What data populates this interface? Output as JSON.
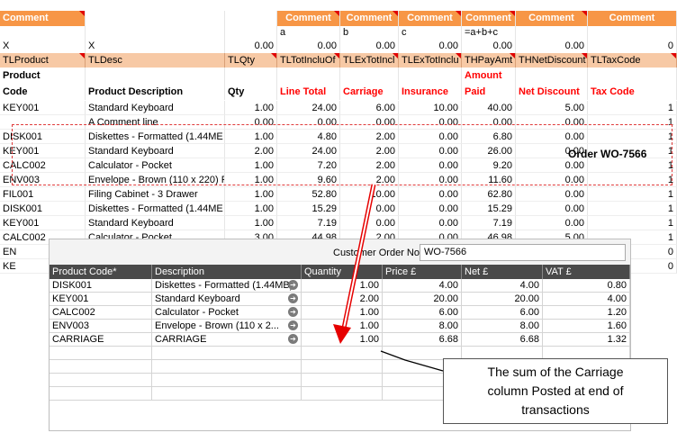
{
  "comment_row": {
    "first": "Comment",
    "cols": [
      "Comment",
      "Comment",
      "Comment",
      "Comment",
      "Comment",
      "Comment"
    ]
  },
  "formula_row": [
    "a",
    "b",
    "c",
    "=a+b+c"
  ],
  "x_row": {
    "a": "X",
    "b": "X",
    "qty": "0.00",
    "vals": [
      "0.00",
      "0.00",
      "0.00",
      "0.00",
      "0.00",
      "0"
    ]
  },
  "tl_row": [
    "TLProduct",
    "TLDesc",
    "TLQty",
    "TLTotIncluOf",
    "TLExTotIncl",
    "TLExTotInclu",
    "THPayAmt",
    "THNetDiscount",
    "TLTaxCode"
  ],
  "headers": {
    "product": [
      "Product",
      "Code"
    ],
    "desc": "Product Description",
    "qty": "Qty",
    "line_total": "Line Total",
    "carriage": "Carriage",
    "insurance": "Insurance",
    "amount_paid": [
      "Amount",
      "Paid"
    ],
    "net_discount": "Net Discount",
    "tax_code": "Tax Code"
  },
  "rows": [
    {
      "code": "KEY001",
      "desc": "Standard Keyboard",
      "qty": "1.00",
      "total": "24.00",
      "carriage": "6.00",
      "insurance": "10.00",
      "paid": "40.00",
      "discount": "5.00",
      "tax": "1"
    },
    {
      "code": "",
      "desc": "A Comment line",
      "qty": "0.00",
      "total": "0.00",
      "carriage": "0.00",
      "insurance": "0.00",
      "paid": "0.00",
      "discount": "0.00",
      "tax": "1"
    },
    {
      "code": "DISK001",
      "desc": "Diskettes - Formatted (1.44ME",
      "qty": "1.00",
      "total": "4.80",
      "carriage": "2.00",
      "insurance": "0.00",
      "paid": "6.80",
      "discount": "0.00",
      "tax": "1"
    },
    {
      "code": "KEY001",
      "desc": "Standard Keyboard",
      "qty": "2.00",
      "total": "24.00",
      "carriage": "2.00",
      "insurance": "0.00",
      "paid": "26.00",
      "discount": "0.00",
      "tax": "1"
    },
    {
      "code": "CALC002",
      "desc": "Calculator - Pocket",
      "qty": "1.00",
      "total": "7.20",
      "carriage": "2.00",
      "insurance": "0.00",
      "paid": "9.20",
      "discount": "0.00",
      "tax": "1"
    },
    {
      "code": "ENV003",
      "desc": "Envelope - Brown (110 x 220) F",
      "qty": "1.00",
      "total": "9.60",
      "carriage": "2.00",
      "insurance": "0.00",
      "paid": "11.60",
      "discount": "0.00",
      "tax": "1"
    },
    {
      "code": "FIL001",
      "desc": "Filing Cabinet - 3 Drawer",
      "qty": "1.00",
      "total": "52.80",
      "carriage": "10.00",
      "insurance": "0.00",
      "paid": "62.80",
      "discount": "0.00",
      "tax": "1"
    },
    {
      "code": "DISK001",
      "desc": "Diskettes - Formatted (1.44ME",
      "qty": "1.00",
      "total": "15.29",
      "carriage": "0.00",
      "insurance": "0.00",
      "paid": "15.29",
      "discount": "0.00",
      "tax": "1"
    },
    {
      "code": "KEY001",
      "desc": "Standard Keyboard",
      "qty": "1.00",
      "total": "7.19",
      "carriage": "0.00",
      "insurance": "0.00",
      "paid": "7.19",
      "discount": "0.00",
      "tax": "1"
    },
    {
      "code": "CALC002",
      "desc": "Calculator - Pocket",
      "qty": "3.00",
      "total": "44.98",
      "carriage": "2.00",
      "insurance": "0.00",
      "paid": "46.98",
      "discount": "5.00",
      "tax": "1"
    },
    {
      "code": "EN",
      "desc": "",
      "qty": "",
      "total": "",
      "carriage": "",
      "insurance": "",
      "paid": "",
      "discount": "",
      "tax": "0"
    },
    {
      "code": "KE",
      "desc": "",
      "qty": "",
      "total": "",
      "carriage": "",
      "insurance": "",
      "paid": "",
      "discount": "",
      "tax": "0"
    }
  ],
  "order_label": "Order WO-7566",
  "dialog": {
    "customer_order_label": "Customer Order No.",
    "customer_order_value": "WO-7566",
    "columns": [
      "Product Code*",
      "Description",
      "Quantity",
      "Price £",
      "Net £",
      "VAT £"
    ],
    "rows": [
      {
        "code": "DISK001",
        "desc": "Diskettes - Formatted (1.44MB)",
        "qty": "1.00",
        "price": "4.00",
        "net": "4.00",
        "vat": "0.80"
      },
      {
        "code": "KEY001",
        "desc": "Standard Keyboard",
        "qty": "2.00",
        "price": "20.00",
        "net": "20.00",
        "vat": "4.00"
      },
      {
        "code": "CALC002",
        "desc": "Calculator - Pocket",
        "qty": "1.00",
        "price": "6.00",
        "net": "6.00",
        "vat": "1.20"
      },
      {
        "code": "ENV003",
        "desc": "Envelope - Brown (110 x 2...",
        "qty": "1.00",
        "price": "8.00",
        "net": "8.00",
        "vat": "1.60"
      },
      {
        "code": "CARRIAGE",
        "desc": "CARRIAGE",
        "qty": "1.00",
        "price": "6.68",
        "net": "6.68",
        "vat": "1.32"
      }
    ]
  },
  "callout": [
    "The sum of the Carriage",
    "column Posted at end of",
    "transactions"
  ],
  "colors": {
    "header_orange": "#f79646",
    "tl_peach": "#f7c9a5",
    "red_text": "#ff0000",
    "dash_red": "#e03a3a"
  }
}
